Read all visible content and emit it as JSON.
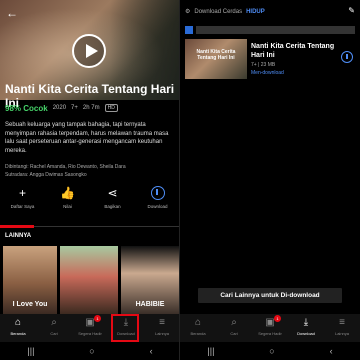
{
  "left": {
    "title": "Nanti Kita Cerita Tentang Hari Ini",
    "match": "98% Cocok",
    "year": "2020",
    "rating": "7+",
    "duration": "2h 7m",
    "quality": "HD",
    "synopsis": "Sebuah keluarga yang tampak bahagia, tapi ternyata menyimpan rahasia terpendam, harus melawan trauma masa lalu saat perseteruan antar-generasi mengancam keutuhan mereka.",
    "cast": "Dibintangi: Rachel Amanda, Rio Dewanto, Sheila Dara",
    "director": "Sutradara: Angga Dwimas Sasongko",
    "actions": [
      {
        "icon": "plus-icon",
        "label": "Daftar Saya"
      },
      {
        "icon": "thumbs-up-icon",
        "label": "Nilai"
      },
      {
        "icon": "share-icon",
        "label": "Bagikan"
      },
      {
        "icon": "download-icon",
        "label": "Download"
      }
    ],
    "section_label": "LAINNYA",
    "thumbs": [
      {
        "caption": "I Love You"
      },
      {
        "caption": ""
      },
      {
        "caption": "HABIBIE"
      }
    ]
  },
  "nav": [
    {
      "icon": "home-icon",
      "label": "Beranda"
    },
    {
      "icon": "search-icon",
      "label": "Cari"
    },
    {
      "icon": "coming-soon-icon",
      "label": "Segera Hadir"
    },
    {
      "icon": "download-icon",
      "label": "Download"
    },
    {
      "icon": "menu-icon",
      "label": "Lainnya"
    }
  ],
  "right": {
    "smart_download_label": "Download Cerdas",
    "smart_download_state": "HIDUP",
    "item": {
      "thumb_caption": "Nanti Kita Cerita Tentang Hari Ini",
      "title": "Nanti Kita Cerita Tentang Hari Ini",
      "meta": "7+ | 23 MB",
      "status": "Men-download"
    },
    "find_more": "Cari Lainnya untuk Di-download"
  },
  "colors": {
    "accent": "#e50914",
    "match": "#46d369",
    "blue": "#4f8ef7"
  }
}
